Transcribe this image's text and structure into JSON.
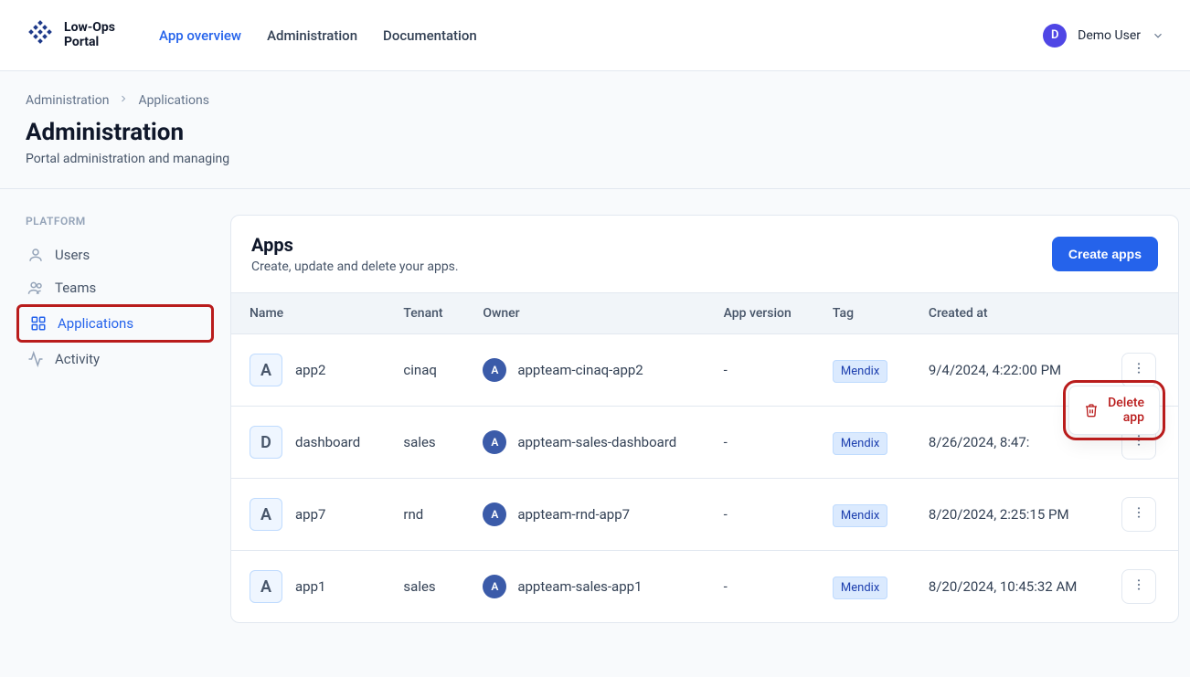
{
  "brand": {
    "name": "Low-Ops\nPortal"
  },
  "nav": {
    "items": [
      {
        "label": "App overview",
        "active": true
      },
      {
        "label": "Administration",
        "active": false
      },
      {
        "label": "Documentation",
        "active": false
      }
    ]
  },
  "user": {
    "initial": "D",
    "display_name": "Demo User"
  },
  "breadcrumb": {
    "items": [
      "Administration",
      "Applications"
    ]
  },
  "page": {
    "title": "Administration",
    "subtitle": "Portal administration and managing"
  },
  "sidebar": {
    "group_label": "PLATFORM",
    "items": [
      {
        "label": "Users",
        "icon": "user-icon"
      },
      {
        "label": "Teams",
        "icon": "users-icon"
      },
      {
        "label": "Applications",
        "icon": "apps-icon",
        "active": true,
        "highlighted": true
      },
      {
        "label": "Activity",
        "icon": "activity-icon"
      }
    ]
  },
  "card": {
    "title": "Apps",
    "subtitle": "Create, update and delete your apps.",
    "create_button": "Create apps"
  },
  "table": {
    "columns": [
      "Name",
      "Tenant",
      "Owner",
      "App version",
      "Tag",
      "Created at"
    ],
    "rows": [
      {
        "badge": "A",
        "name": "app2",
        "tenant": "cinaq",
        "owner_initial": "A",
        "owner": "appteam-cinaq-app2",
        "version": "-",
        "tag": "Mendix",
        "created_at": "9/4/2024, 4:22:00 PM"
      },
      {
        "badge": "D",
        "name": "dashboard",
        "tenant": "sales",
        "owner_initial": "A",
        "owner": "appteam-sales-dashboard",
        "version": "-",
        "tag": "Mendix",
        "created_at": "8/26/2024, 8:47:"
      },
      {
        "badge": "A",
        "name": "app7",
        "tenant": "rnd",
        "owner_initial": "A",
        "owner": "appteam-rnd-app7",
        "version": "-",
        "tag": "Mendix",
        "created_at": "8/20/2024, 2:25:15 PM"
      },
      {
        "badge": "A",
        "name": "app1",
        "tenant": "sales",
        "owner_initial": "A",
        "owner": "appteam-sales-app1",
        "version": "-",
        "tag": "Mendix",
        "created_at": "8/20/2024, 10:45:32 AM"
      }
    ]
  },
  "popover": {
    "label": "Delete app"
  }
}
